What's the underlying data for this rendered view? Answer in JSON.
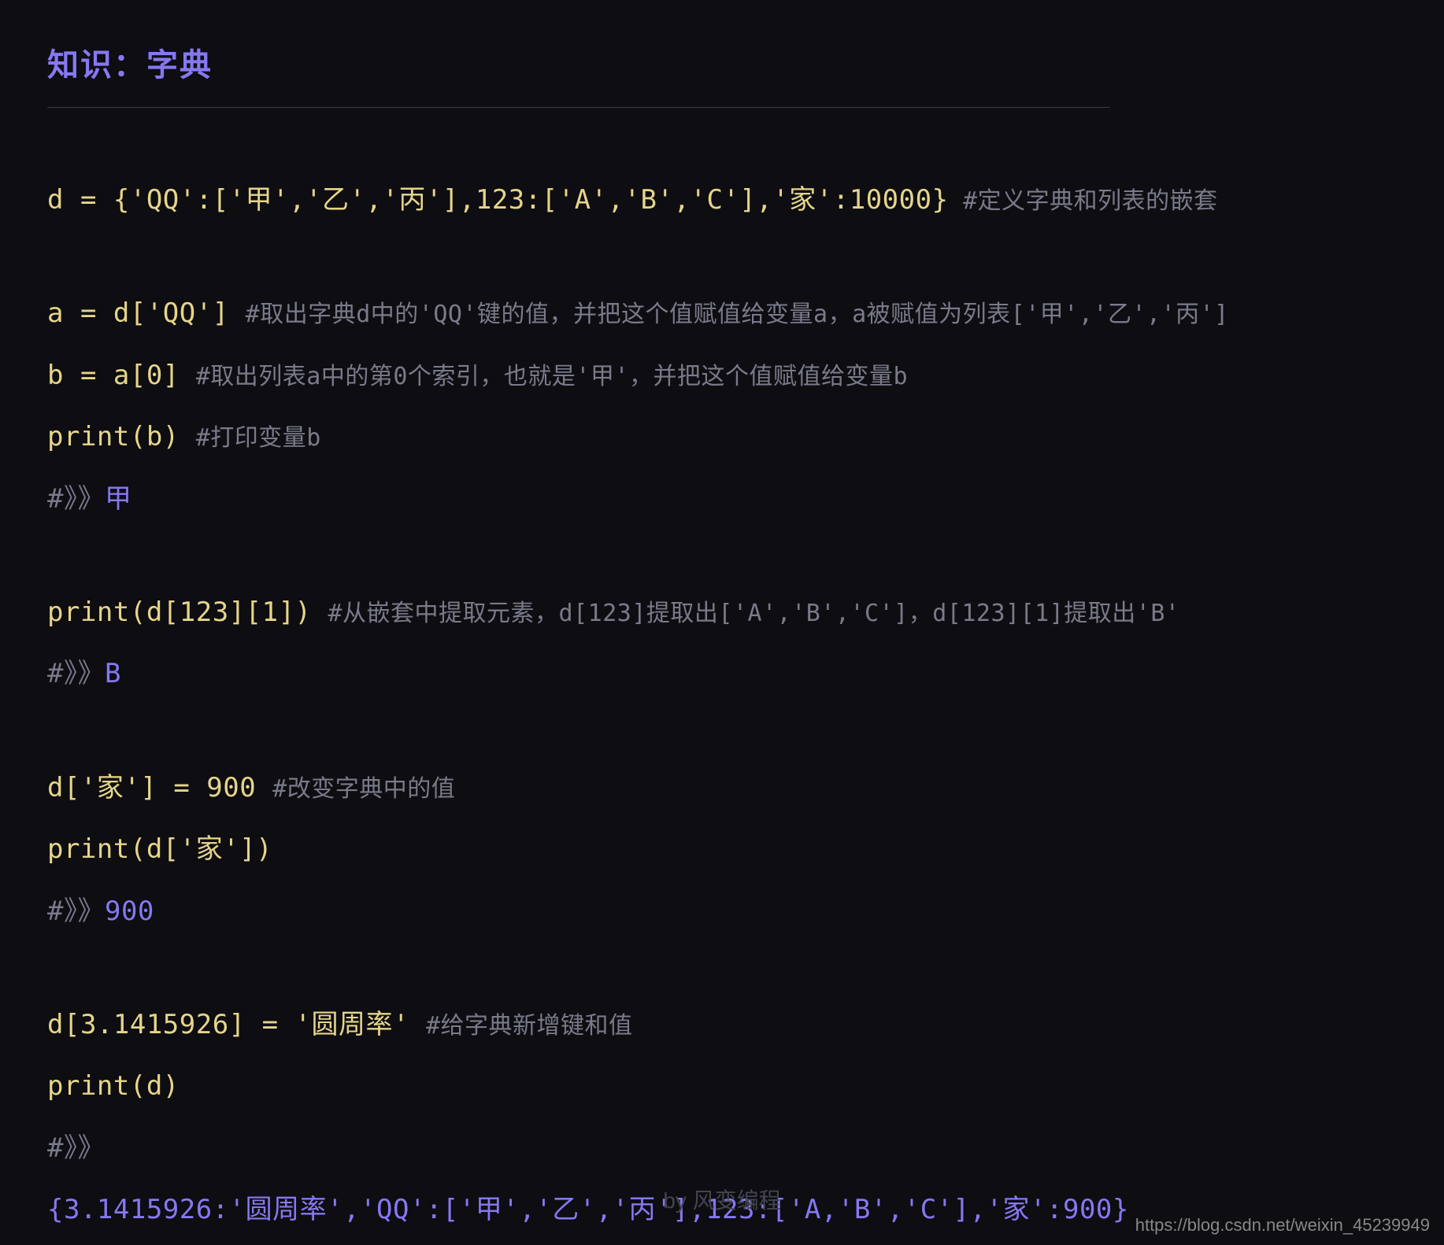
{
  "title": "知识：字典",
  "block1": {
    "line1": {
      "code": "d = {'QQ':['甲','乙','丙'],123:['A','B','C'],'家':10000}",
      "comment": " #定义字典和列表的嵌套"
    }
  },
  "block2": {
    "line1": {
      "code": "a = d['QQ']  ",
      "comment": "#取出字典d中的'QQ'键的值，并把这个值赋值给变量a，a被赋值为列表['甲','乙','丙']"
    },
    "line2": {
      "code": "b = a[0]  ",
      "comment": "#取出列表a中的第0个索引，也就是'甲'，并把这个值赋值给变量b"
    },
    "line3": {
      "code": "print(b)  ",
      "comment": "#打印变量b"
    },
    "line4": {
      "marker": "#》》",
      "value": "甲"
    }
  },
  "block3": {
    "line1": {
      "code": "print(d[123][1]) ",
      "comment": "#从嵌套中提取元素，d[123]提取出['A','B','C']，d[123][1]提取出'B'"
    },
    "line2": {
      "marker": "#》》",
      "value": "B"
    }
  },
  "block4": {
    "line1": {
      "code": "d['家'] = 900   ",
      "comment": "#改变字典中的值"
    },
    "line2": {
      "code": "print(d['家'])"
    },
    "line3": {
      "marker": "#》》",
      "value": "900"
    }
  },
  "block5": {
    "line1": {
      "code": "d[3.1415926] = '圆周率'  ",
      "comment": "#给字典新增键和值"
    },
    "line2": {
      "code": "print(d)"
    },
    "line3": {
      "marker": "#》》"
    },
    "final": "{3.1415926:'圆周率','QQ':['甲','乙','丙'],123:['A,'B','C'],'家':900}"
  },
  "credit": "by 风变编程",
  "watermark": "https://blog.csdn.net/weixin_45239949"
}
